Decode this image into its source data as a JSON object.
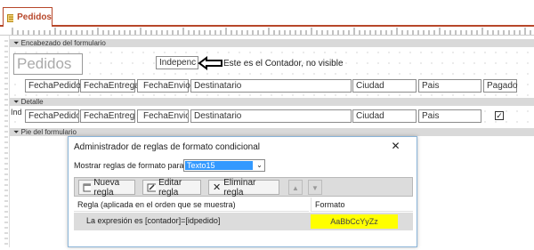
{
  "tab": {
    "title": "Pedidos"
  },
  "sections": {
    "header": "Encabezado del formulario",
    "detail": "Detalle",
    "footer": "Pie del formulario"
  },
  "header_area": {
    "title_label": "Pedidos",
    "counter_box": "Indepenc",
    "annotation": "Este es el Contador, no visible",
    "columns": [
      "FechaPedido",
      "FechaEntrega",
      "FechaEnvio",
      "Destinatario",
      "Ciudad",
      "Pais",
      "Pagado"
    ]
  },
  "detail_area": {
    "left_marker": "Ind",
    "fields": [
      "FechaPedido",
      "FechaEntrega",
      "FechaEnvio",
      "Destinatario",
      "Ciudad",
      "Pais"
    ],
    "checkbox_checked": true
  },
  "dialog": {
    "title": "Administrador de reglas de formato condicional",
    "close_glyph": "✕",
    "show_rules_label": "Mostrar reglas de formato para:",
    "show_rules_value": "Texto15",
    "buttons": {
      "new": "Nueva regla",
      "edit": "Editar regla",
      "delete": "Eliminar regla"
    },
    "table_headers": {
      "rule": "Regla (aplicada en el orden que se muestra)",
      "format": "Formato"
    },
    "rules": [
      {
        "expression": "La expresión es [contador]=[idpedido]",
        "preview": "AaBbCcYyZz",
        "preview_color": "#ffff00"
      }
    ]
  }
}
